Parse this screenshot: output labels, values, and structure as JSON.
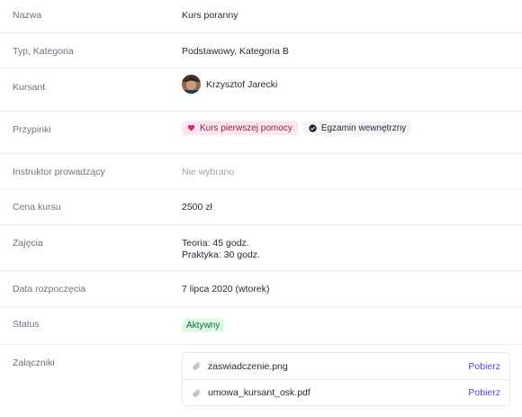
{
  "fields": {
    "name": {
      "label": "Nazwa",
      "value": "Kurs poranny"
    },
    "type": {
      "label": "Typ, Kategoria",
      "value": "Podstawowy, Kategoria B"
    },
    "student": {
      "label": "Kursant",
      "value": "Krzysztof Jarecki"
    },
    "pins": {
      "label": "Przypinki",
      "items": [
        {
          "label": "Kurs pierwszej pomocy",
          "icon": "heart-icon",
          "color": "#fce7f0"
        },
        {
          "label": "Egzamin wewnętrzny",
          "icon": "check-circle-icon",
          "color": "#f3f4f6"
        }
      ]
    },
    "instructor": {
      "label": "Instruktor prowadzący",
      "value": "Nie wybrano"
    },
    "price": {
      "label": "Cena kursu",
      "value": "2500 zł"
    },
    "classes": {
      "label": "Zajęcia",
      "lines": [
        "Teoria: 45 godz.",
        "Praktyka: 30 godz."
      ]
    },
    "start_date": {
      "label": "Data rozpoczęcia",
      "value": "7 lipca 2020 (wtorek)"
    },
    "status": {
      "label": "Status",
      "value": "Aktywny",
      "color": "#dcfce7"
    },
    "attachments": {
      "label": "Załączniki",
      "files": [
        {
          "name": "zaswiadczenie.png",
          "action": "Pobierz",
          "icon": "paperclip-icon"
        },
        {
          "name": "umowa_kursant_osk.pdf",
          "action": "Pobierz",
          "icon": "paperclip-icon"
        }
      ]
    }
  },
  "colors": {
    "accent": "#4f46e5",
    "divider": "#eceef1"
  }
}
